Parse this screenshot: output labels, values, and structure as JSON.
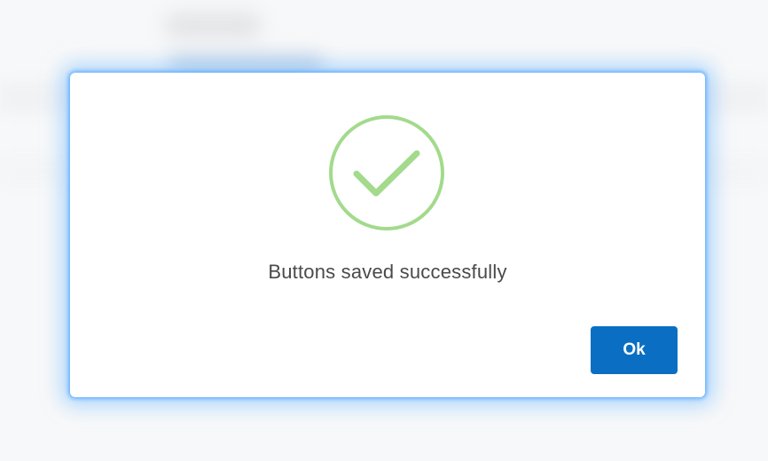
{
  "dialog": {
    "icon": "check-circle-icon",
    "message": "Buttons saved successfully",
    "ok_label": "Ok"
  },
  "colors": {
    "success": "#a3da8c",
    "primary": "#0a6fc2",
    "dialog_glow": "#78beff"
  }
}
